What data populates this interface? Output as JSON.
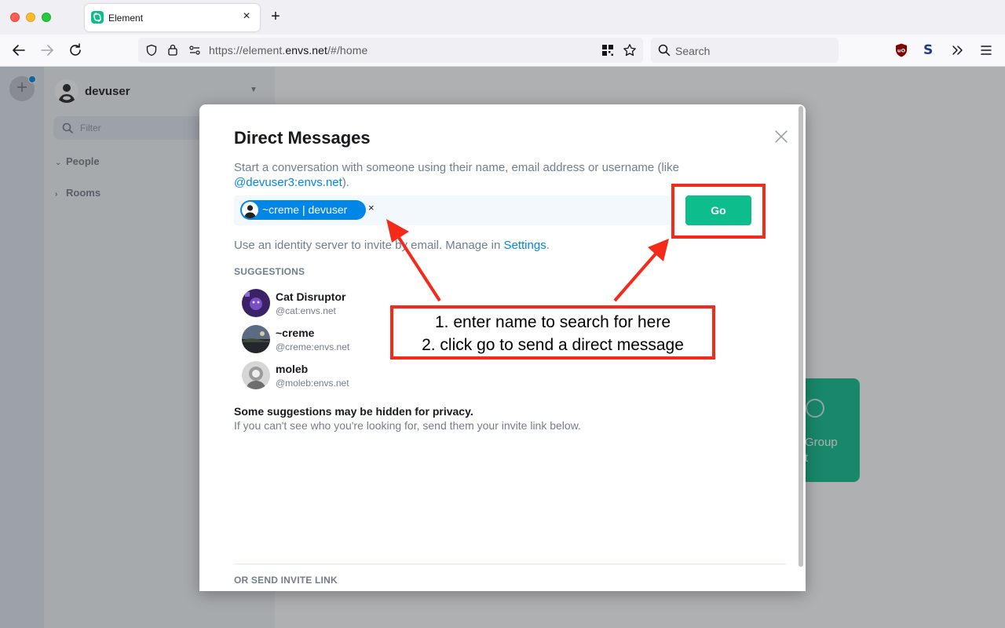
{
  "browser": {
    "tab_title": "Element",
    "tab_close": "×",
    "new_tab": "+",
    "url_prefix": "https://element.",
    "url_domain": "envs.net",
    "url_suffix": "/#/home",
    "search_placeholder": "Search"
  },
  "app": {
    "user_name": "devuser",
    "filter_placeholder": "Filter",
    "sections": [
      {
        "label": "People",
        "chevron": "⌄"
      },
      {
        "label": "Rooms",
        "chevron": "›"
      }
    ],
    "group_card_label": "Group\nt"
  },
  "modal": {
    "title": "Direct Messages",
    "description_before": "Start a conversation with someone using their name, email address or username (like ",
    "description_link": "@devuser3:envs.net",
    "description_after": ").",
    "pill_label": "~creme | devuser",
    "pill_remove": "×",
    "go_label": "Go",
    "identity_before": "Use an identity server to invite by email. Manage in ",
    "identity_link": "Settings",
    "identity_after": ".",
    "suggestions_header": "SUGGESTIONS",
    "suggestions": [
      {
        "name": "Cat Disruptor",
        "id": "@cat:envs.net"
      },
      {
        "name": "~creme",
        "id": "@creme:envs.net"
      },
      {
        "name": "moleb",
        "id": "@moleb:envs.net"
      }
    ],
    "privacy_header": "Some suggestions may be hidden for privacy.",
    "privacy_text": "If you can't see who you're looking for, send them your invite link below.",
    "or_send_invite": "OR SEND INVITE LINK"
  },
  "annotation": {
    "line1": "1. enter name to search for here",
    "line2": "2. click go to send a direct message",
    "color": "#f42a1a"
  }
}
